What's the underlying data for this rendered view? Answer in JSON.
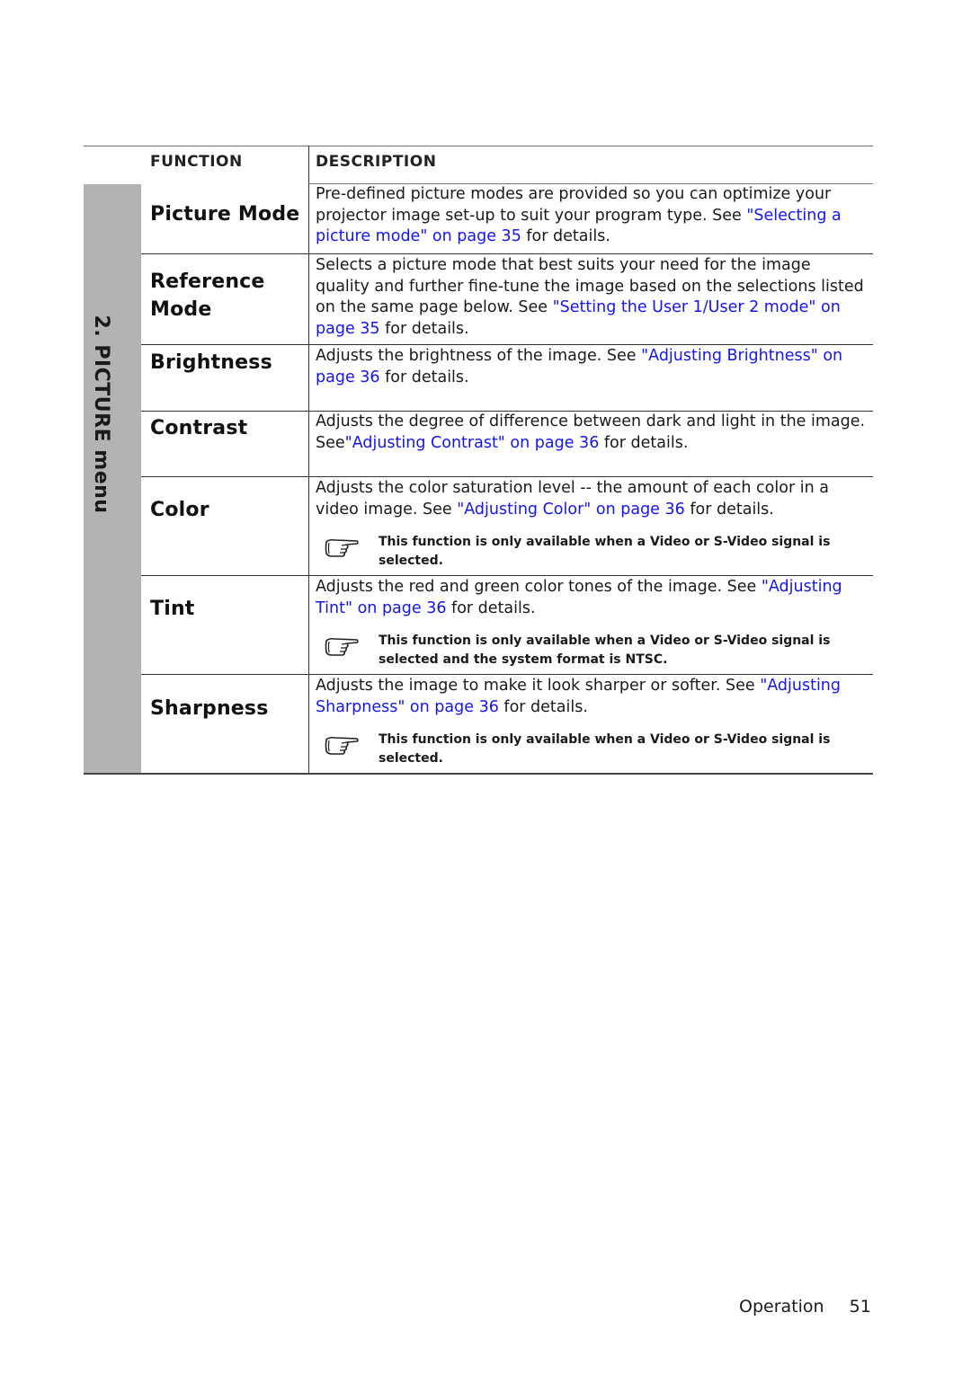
{
  "table": {
    "headers": {
      "function": "FUNCTION",
      "description": "DESCRIPTION"
    },
    "section_tab": "2. PICTURE menu",
    "rows": [
      {
        "function": "Picture Mode",
        "description": [
          {
            "text": "Pre-defined picture modes are provided so you can optimize your projector image set-up to suit your program type. See ",
            "link": false
          },
          {
            "text": "\"Selecting a picture mode\" on page 35",
            "link": true
          },
          {
            "text": " for details.",
            "link": false
          }
        ]
      },
      {
        "function": "Reference Mode",
        "function_lines": [
          "Reference",
          "Mode"
        ],
        "description": [
          {
            "text": "Selects a picture mode that best suits your need for the image quality and further fine-tune the image based on the selections listed on the same page below. See ",
            "link": false
          },
          {
            "text": "\"Setting the User 1/User 2 mode\" on page 35",
            "link": true
          },
          {
            "text": " for details.",
            "link": false
          }
        ]
      },
      {
        "function": "Brightness",
        "description": [
          {
            "text": "Adjusts the brightness of the image. See ",
            "link": false
          },
          {
            "text": "\"Adjusting Brightness\" on page 36",
            "link": true
          },
          {
            "text": " for details.",
            "link": false
          }
        ]
      },
      {
        "function": "Contrast",
        "description": [
          {
            "text": "Adjusts the degree of difference between dark and light in the image. See",
            "link": false
          },
          {
            "text": "\"Adjusting Contrast\" on page 36",
            "link": true
          },
          {
            "text": " for details.",
            "link": false
          }
        ]
      },
      {
        "function": "Color",
        "description": [
          {
            "text": "Adjusts the color saturation level -- the amount of each color in a video image. See ",
            "link": false
          },
          {
            "text": "\"Adjusting Color\" on page 36",
            "link": true
          },
          {
            "text": " for details.",
            "link": false
          }
        ],
        "note": {
          "icon": "pointing-hand-icon",
          "text": "This function is only available when a Video or S-Video signal is selected."
        }
      },
      {
        "function": "Tint",
        "description": [
          {
            "text": "Adjusts the red and green color tones of the image. See ",
            "link": false
          },
          {
            "text": "\"Adjusting Tint\" on page 36",
            "link": true
          },
          {
            "text": " for details.",
            "link": false
          }
        ],
        "note": {
          "icon": "pointing-hand-icon",
          "text": "This function is only available when a Video or S-Video signal is selected and the system format is NTSC."
        }
      },
      {
        "function": "Sharpness",
        "description": [
          {
            "text": "Adjusts the image to make it look sharper or softer. See ",
            "link": false
          },
          {
            "text": "\"Adjusting Sharpness\" on page 36",
            "link": true
          },
          {
            "text": " for details.",
            "link": false
          }
        ],
        "note": {
          "icon": "pointing-hand-icon",
          "text": "This function is only available when a Video or S-Video signal is selected."
        }
      }
    ]
  },
  "footer": {
    "section": "Operation",
    "page_number": "51"
  },
  "colors": {
    "link": "#1515ee",
    "side_tab": "#b3b3b3",
    "text": "#1a1a1a"
  }
}
